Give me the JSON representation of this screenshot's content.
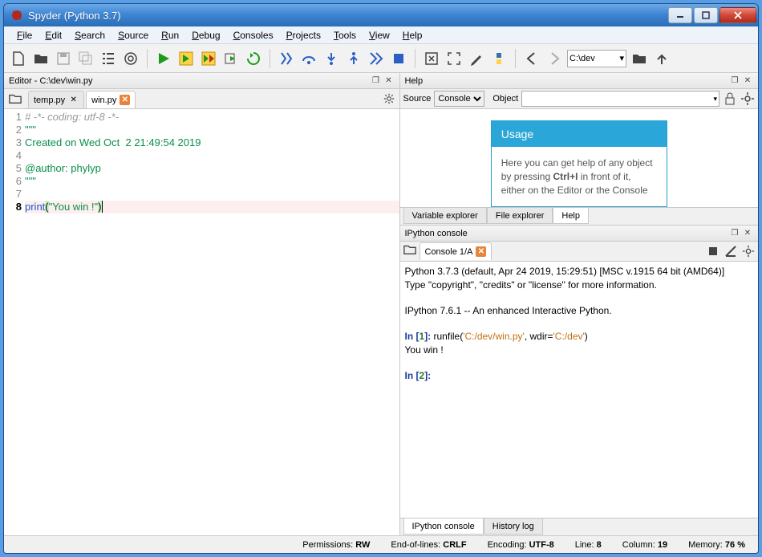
{
  "window": {
    "title": "Spyder (Python 3.7)"
  },
  "menu": [
    "File",
    "Edit",
    "Search",
    "Source",
    "Run",
    "Debug",
    "Consoles",
    "Projects",
    "Tools",
    "View",
    "Help"
  ],
  "toolbar": {
    "path": "C:\\dev"
  },
  "editor": {
    "pane_title": "Editor - C:\\dev\\win.py",
    "tabs": [
      {
        "label": "temp.py",
        "active": false,
        "dirty": false
      },
      {
        "label": "win.py",
        "active": true,
        "dirty": true
      }
    ],
    "code": {
      "lines": [
        {
          "n": 1,
          "t": "# -*- coding: utf-8 -*-",
          "type": "comment"
        },
        {
          "n": 2,
          "t": "\"\"\"",
          "type": "str"
        },
        {
          "n": 3,
          "t": "Created on Wed Oct  2 21:49:54 2019",
          "type": "str"
        },
        {
          "n": 4,
          "t": "",
          "type": "plain"
        },
        {
          "n": 5,
          "t": "@author: phylyp",
          "type": "str"
        },
        {
          "n": 6,
          "t": "\"\"\"",
          "type": "str"
        },
        {
          "n": 7,
          "t": "",
          "type": "plain"
        },
        {
          "n": 8,
          "t": "print(\"You win !\")",
          "type": "code8",
          "active": true
        }
      ]
    }
  },
  "help": {
    "pane_title": "Help",
    "source_label": "Source",
    "source_value": "Console",
    "object_label": "Object",
    "card_title": "Usage",
    "card_body_1": "Here you can get help of any object by pressing ",
    "card_body_kbd": "Ctrl+I",
    "card_body_2": " in front of it, either on the Editor or the Console",
    "tabs": [
      "Variable explorer",
      "File explorer",
      "Help"
    ],
    "active_tab": "Help"
  },
  "ipython": {
    "pane_title": "IPython console",
    "tab_label": "Console 1/A",
    "banner_1": "Python 3.7.3 (default, Apr 24 2019, 15:29:51) [MSC v.1915 64 bit (AMD64)]",
    "banner_2": "Type \"copyright\", \"credits\" or \"license\" for more information.",
    "banner_3": "IPython 7.6.1 -- An enhanced Interactive Python.",
    "in1_pre": "In [",
    "in1_n": "1",
    "in1_post": "]: ",
    "in1_cmd": "runfile(",
    "in1_arg1": "'C:/dev/win.py'",
    "in1_mid": ", wdir=",
    "in1_arg2": "'C:/dev'",
    "in1_end": ")",
    "out1": "You win !",
    "in2_pre": "In [",
    "in2_n": "2",
    "in2_post": "]: ",
    "bottom_tabs": [
      "IPython console",
      "History log"
    ],
    "active_tab": "IPython console"
  },
  "status": {
    "perm_label": "Permissions:",
    "perm_val": "RW",
    "eol_label": "End-of-lines:",
    "eol_val": "CRLF",
    "enc_label": "Encoding:",
    "enc_val": "UTF-8",
    "line_label": "Line:",
    "line_val": "8",
    "col_label": "Column:",
    "col_val": "19",
    "mem_label": "Memory:",
    "mem_val": "76 %"
  }
}
